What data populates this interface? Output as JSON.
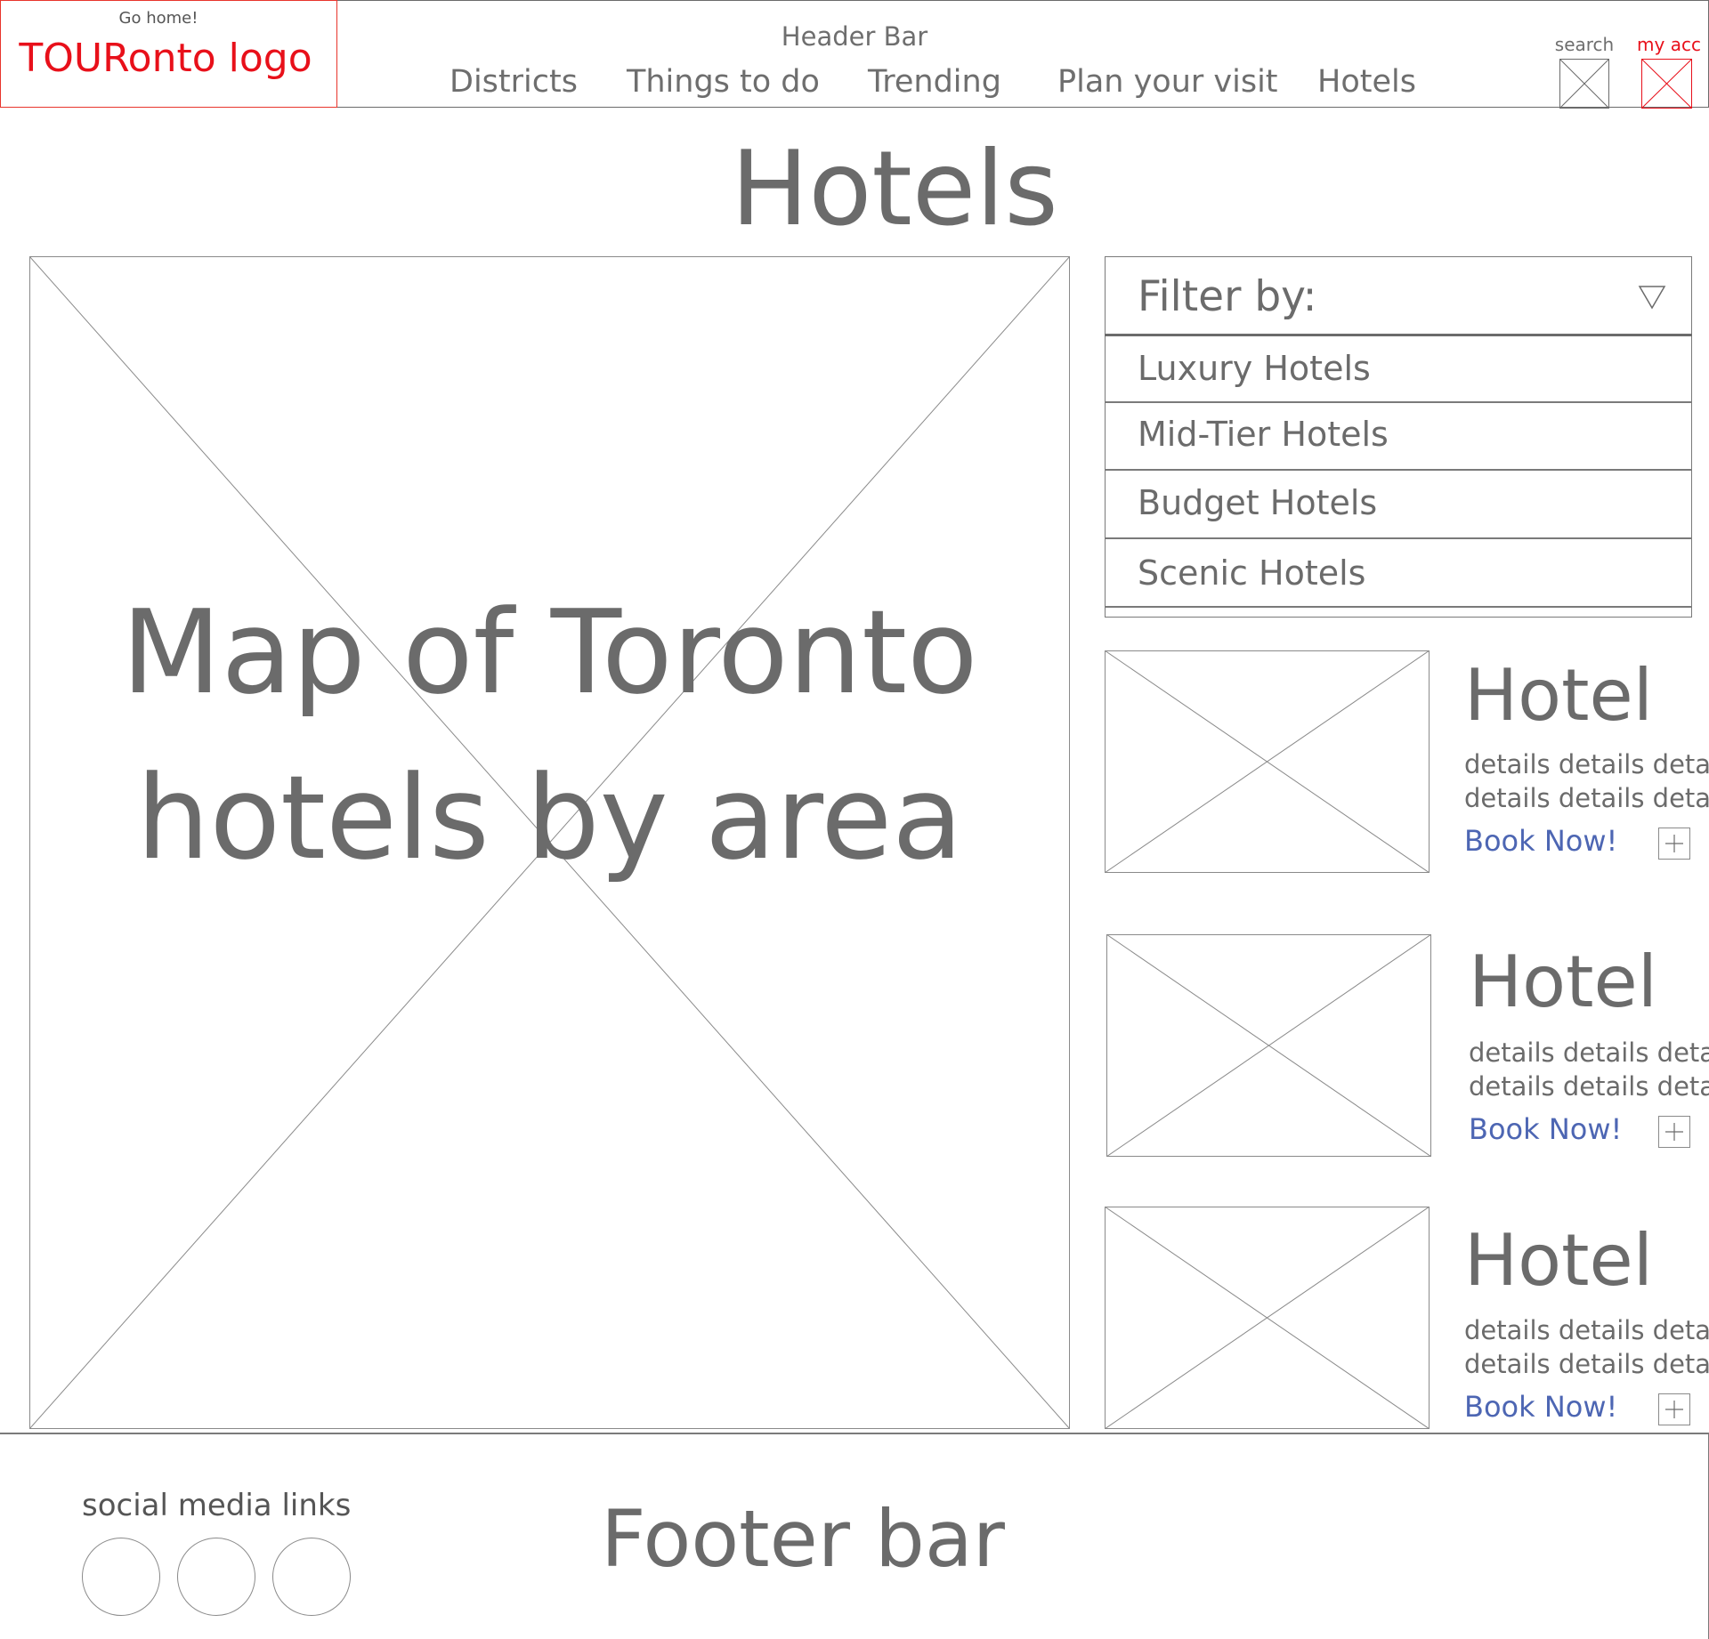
{
  "header": {
    "go_home": "Go home!",
    "logo": "TOURonto logo",
    "title": "Header Bar",
    "nav": [
      "Districts",
      "Things to do",
      "Trending",
      "Plan your visit",
      "Hotels"
    ],
    "search_label": "search",
    "account_label": "my acc"
  },
  "page": {
    "title": "Hotels"
  },
  "map": {
    "line1": "Map of Toronto",
    "line2": "hotels by area"
  },
  "filter": {
    "label": "Filter by:",
    "options": [
      "Luxury Hotels",
      "Mid-Tier Hotels",
      "Budget Hotels",
      "Scenic Hotels"
    ]
  },
  "hotels": [
    {
      "name": "Hotel",
      "details1": "details details details",
      "details2": "details details details",
      "cta": "Book Now!"
    },
    {
      "name": "Hotel",
      "details1": "details details details",
      "details2": "details details details",
      "cta": "Book Now!"
    },
    {
      "name": "Hotel",
      "details1": "details details details",
      "details2": "details details details",
      "cta": "Book Now!"
    }
  ],
  "footer": {
    "social_label": "social media links",
    "title": "Footer bar"
  },
  "colors": {
    "brand": "#e8101a",
    "link": "#4d66b3",
    "text": "#6b6b6b",
    "outline": "#8a8a8a"
  }
}
